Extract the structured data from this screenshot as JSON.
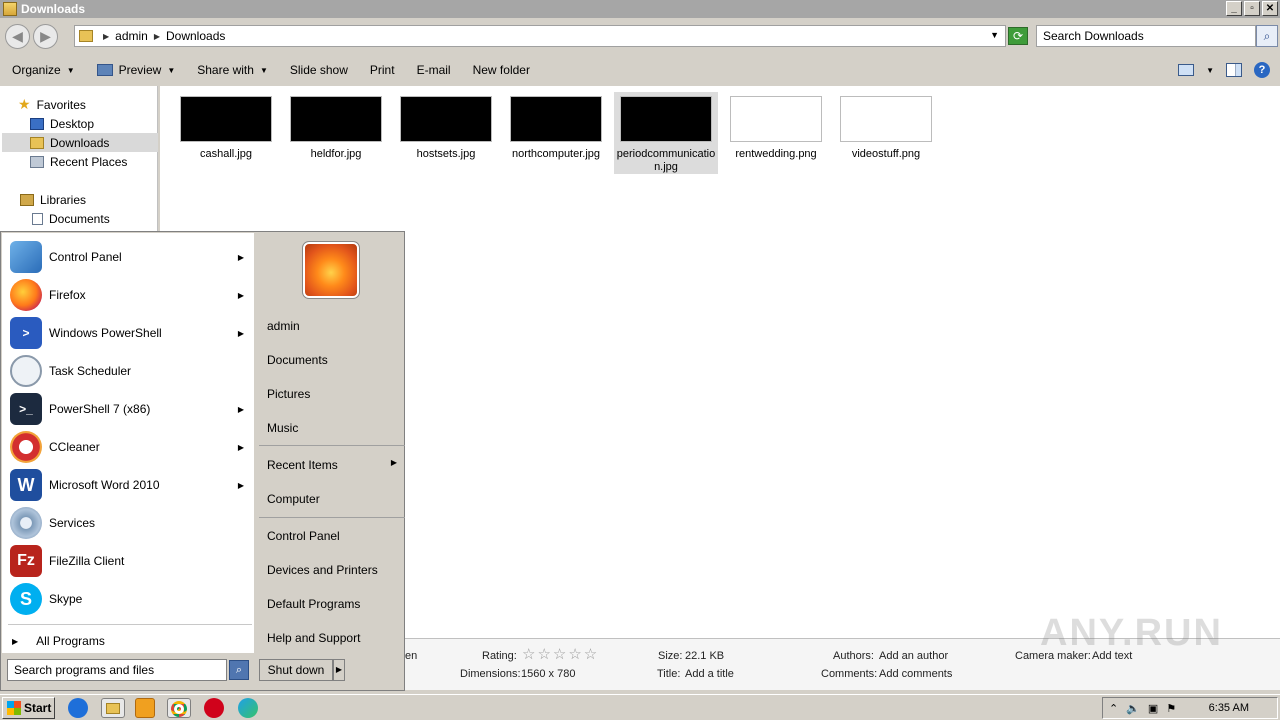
{
  "window": {
    "title": "Downloads"
  },
  "address": {
    "crumbs": [
      "admin",
      "Downloads"
    ],
    "search_placeholder": "Search Downloads"
  },
  "toolbar": {
    "organize": "Organize",
    "preview": "Preview",
    "share_with": "Share with",
    "slide_show": "Slide show",
    "print": "Print",
    "email": "E-mail",
    "new_folder": "New folder"
  },
  "nav": {
    "favorites": "Favorites",
    "desktop": "Desktop",
    "downloads": "Downloads",
    "recent_places": "Recent Places",
    "libraries": "Libraries",
    "documents": "Documents"
  },
  "files": [
    {
      "name": "cashall.jpg",
      "thumb": "dark"
    },
    {
      "name": "heldfor.jpg",
      "thumb": "dark"
    },
    {
      "name": "hostsets.jpg",
      "thumb": "dark"
    },
    {
      "name": "northcomputer.jpg",
      "thumb": "dark"
    },
    {
      "name": "periodcommunication.jpg",
      "thumb": "dark",
      "selected": true
    },
    {
      "name": "rentwedding.png",
      "thumb": "light"
    },
    {
      "name": "videostuff.png",
      "thumb": "light"
    }
  ],
  "details": {
    "partial": "en",
    "rating_label": "Rating:",
    "dimensions_label": "Dimensions:",
    "dimensions": "1560 x 780",
    "size_label": "Size:",
    "size": "22.1 KB",
    "title_label": "Title:",
    "title": "Add a title",
    "authors_label": "Authors:",
    "authors": "Add an author",
    "comments_label": "Comments:",
    "comments": "Add comments",
    "camera_label": "Camera maker:",
    "camera": "Add text",
    "watermark": "ANY.RUN"
  },
  "startmenu": {
    "programs": [
      {
        "label": "Control Panel",
        "icon": "control-panel-icon",
        "arrow": true
      },
      {
        "label": "Firefox",
        "icon": "firefox-icon",
        "arrow": true
      },
      {
        "label": "Windows PowerShell",
        "icon": "powershell-icon",
        "arrow": true
      },
      {
        "label": "Task Scheduler",
        "icon": "task-scheduler-icon",
        "arrow": false
      },
      {
        "label": "PowerShell 7 (x86)",
        "icon": "powershell7-icon",
        "arrow": true
      },
      {
        "label": "CCleaner",
        "icon": "ccleaner-icon",
        "arrow": true
      },
      {
        "label": "Microsoft Word 2010",
        "icon": "word-icon",
        "arrow": true
      },
      {
        "label": "Services",
        "icon": "services-icon",
        "arrow": false
      },
      {
        "label": "FileZilla Client",
        "icon": "filezilla-icon",
        "arrow": false
      },
      {
        "label": "Skype",
        "icon": "skype-icon",
        "arrow": false
      }
    ],
    "all_programs": "All Programs",
    "search_placeholder": "Search programs and files",
    "right": {
      "user": "admin",
      "documents": "Documents",
      "pictures": "Pictures",
      "music": "Music",
      "recent_items": "Recent Items",
      "computer": "Computer",
      "control_panel": "Control Panel",
      "devices_printers": "Devices and Printers",
      "default_programs": "Default Programs",
      "help_support": "Help and Support"
    },
    "shutdown": "Shut down"
  },
  "taskbar": {
    "start": "Start",
    "clock": "6:35 AM"
  }
}
